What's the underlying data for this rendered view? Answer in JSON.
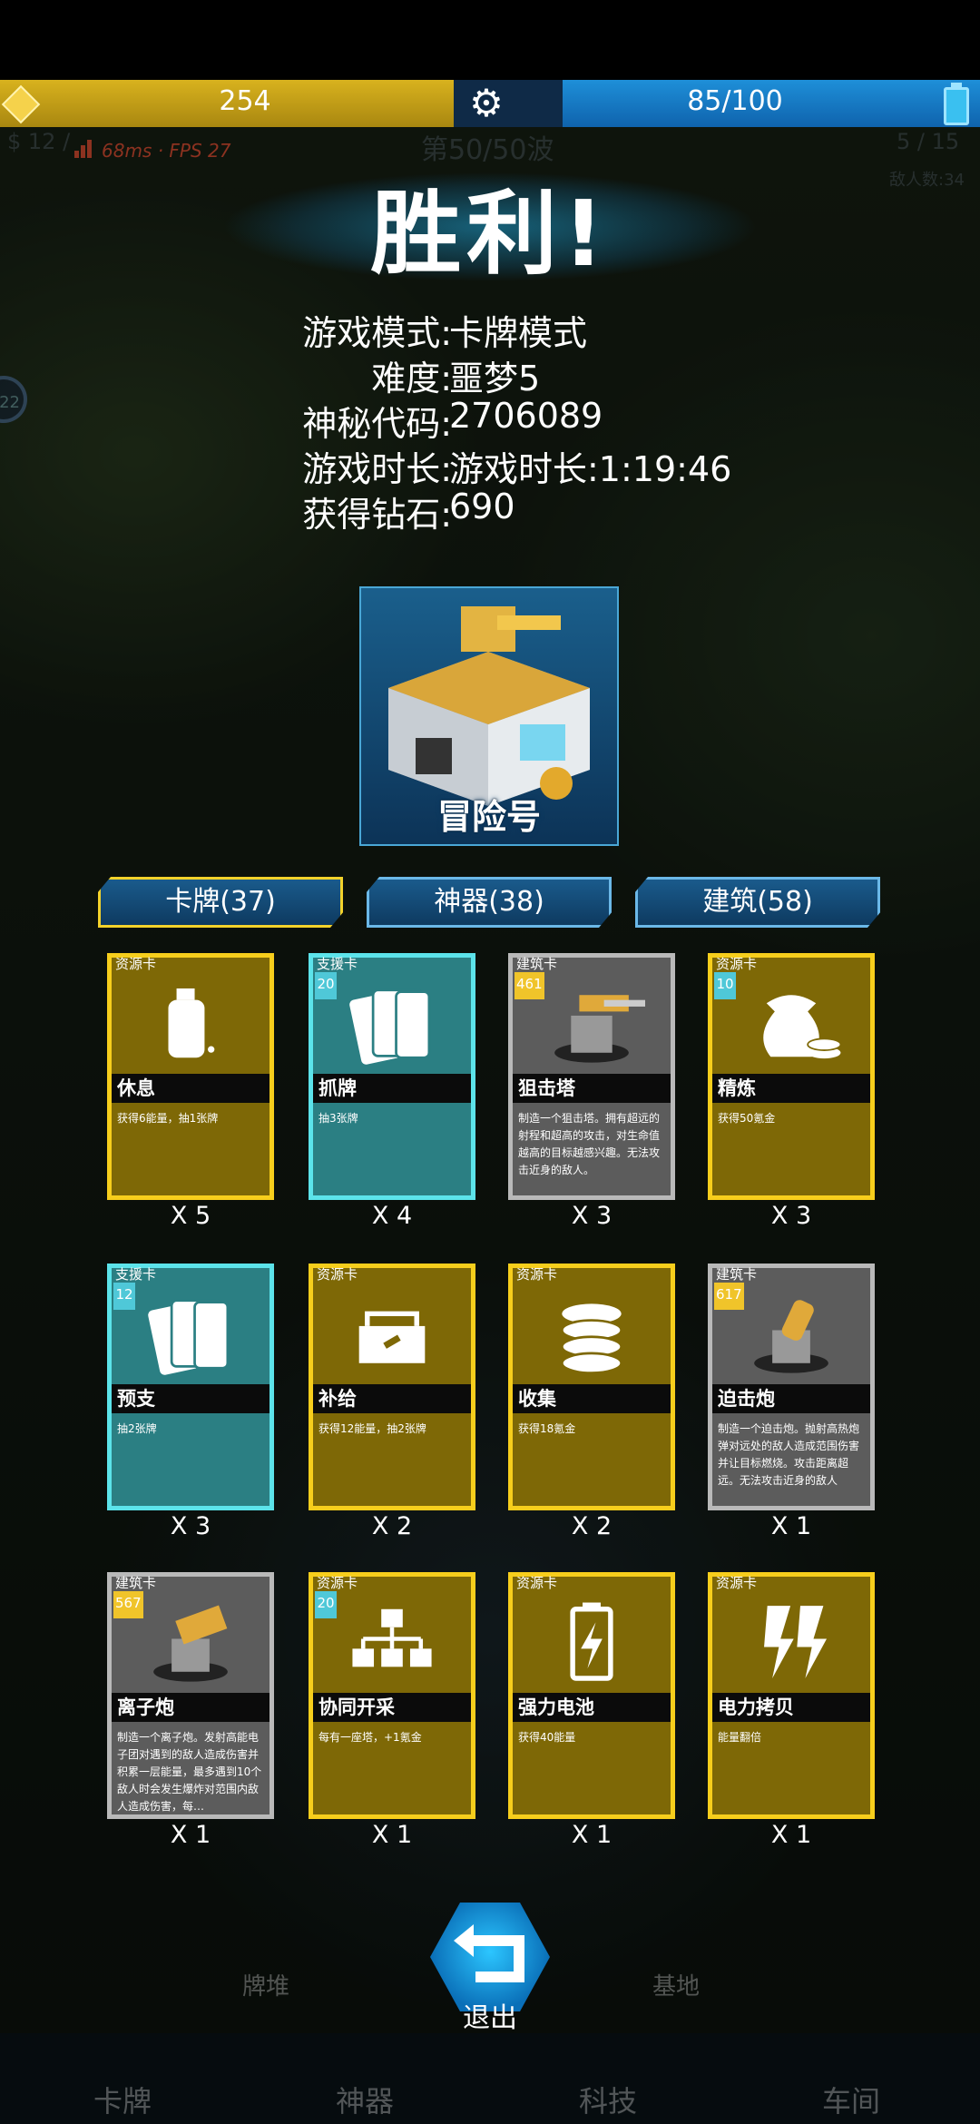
{
  "hud": {
    "gold": "254",
    "energy": "85/100"
  },
  "debug": {
    "fps_text": "68ms · FPS 27"
  },
  "background": {
    "wave": "第50/50波",
    "left_top": "$ 12 /",
    "right_top": "5 / 15",
    "enemies": "敌人数:34",
    "side_badge": "22"
  },
  "result": {
    "title": "胜利!",
    "info": [
      {
        "key": "游戏模式:",
        "value": "卡牌模式"
      },
      {
        "key": "难度:",
        "value": "噩梦5"
      },
      {
        "key": "神秘代码:",
        "value": "2706089"
      },
      {
        "key": "游戏时长:",
        "value": "游戏时长:1:19:46"
      },
      {
        "key": "获得钻石:",
        "value": "690"
      }
    ],
    "hero_name": "冒险号"
  },
  "tabs": [
    {
      "label": "卡牌(37)",
      "active": true
    },
    {
      "label": "神器(38)",
      "active": false
    },
    {
      "label": "建筑(58)",
      "active": false
    }
  ],
  "cards": [
    {
      "type": "资源卡",
      "color": "yellow",
      "name": "休息",
      "desc": "获得6能量，抽1张牌",
      "count": "X 5",
      "icon": "bottle-icon",
      "cost": ""
    },
    {
      "type": "支援卡",
      "color": "cyan",
      "name": "抓牌",
      "desc": "抽3张牌",
      "count": "X 4",
      "icon": "cards-icon",
      "cost": "20"
    },
    {
      "type": "建筑卡",
      "color": "gray",
      "name": "狙击塔",
      "desc": "制造一个狙击塔。拥有超远的射程和超高的攻击，对生命值越高的目标越感兴趣。无法攻击近身的敌人。",
      "count": "X 3",
      "icon": "sniper-tower-icon",
      "cost": "461"
    },
    {
      "type": "资源卡",
      "color": "yellow",
      "name": "精炼",
      "desc": "获得50氪金",
      "count": "X 3",
      "icon": "money-bag-icon",
      "cost": "10"
    },
    {
      "type": "支援卡",
      "color": "cyan",
      "name": "预支",
      "desc": "抽2张牌",
      "count": "X 3",
      "icon": "cards-icon",
      "cost": "12"
    },
    {
      "type": "资源卡",
      "color": "yellow",
      "name": "补给",
      "desc": "获得12能量，抽2张牌",
      "count": "X 2",
      "icon": "supply-box-icon",
      "cost": ""
    },
    {
      "type": "资源卡",
      "color": "yellow",
      "name": "收集",
      "desc": "获得18氪金",
      "count": "X 2",
      "icon": "coin-stack-icon",
      "cost": ""
    },
    {
      "type": "建筑卡",
      "color": "gray",
      "name": "迫击炮",
      "desc": "制造一个迫击炮。抛射高热炮弹对远处的敌人造成范围伤害并让目标燃烧。攻击距离超远。无法攻击近身的敌人",
      "count": "X 1",
      "icon": "mortar-icon",
      "cost": "617"
    },
    {
      "type": "建筑卡",
      "color": "gray",
      "name": "离子炮",
      "desc": "制造一个离子炮。发射高能电子团对遇到的敌人造成伤害并积累一层能量，最多遇到10个敌人时会发生爆炸对范围内敌人造成伤害，每…",
      "count": "X 1",
      "icon": "ion-cannon-icon",
      "cost": "567"
    },
    {
      "type": "资源卡",
      "color": "yellow",
      "name": "协同开采",
      "desc": "每有一座塔，+1氪金",
      "count": "X 1",
      "icon": "hierarchy-icon",
      "cost": "20"
    },
    {
      "type": "资源卡",
      "color": "yellow",
      "name": "强力电池",
      "desc": "获得40能量",
      "count": "X 1",
      "icon": "battery-icon",
      "cost": ""
    },
    {
      "type": "资源卡",
      "color": "yellow",
      "name": "电力拷贝",
      "desc": "能量翻倍",
      "count": "X 1",
      "icon": "lightning-icon",
      "cost": ""
    }
  ],
  "exit_label": "退出",
  "bottom_nav": [
    "牌堆",
    "基地",
    "卡牌",
    "神器",
    "科技",
    "车间"
  ]
}
